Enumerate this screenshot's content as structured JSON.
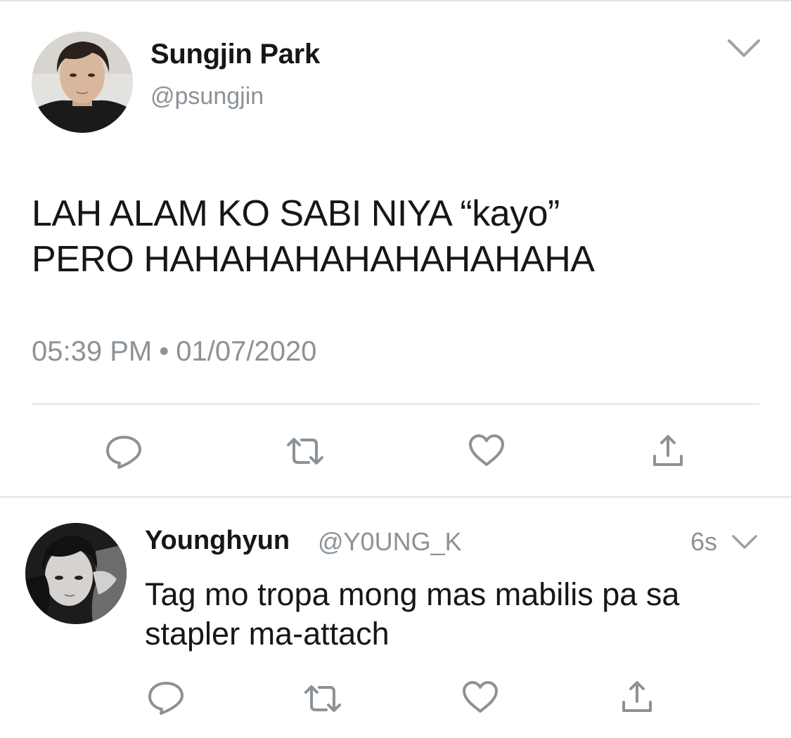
{
  "tweet": {
    "author": {
      "name": "Sungjin Park",
      "handle": "@psungjin"
    },
    "text_lines": [
      "LAH ALAM KO SABI NIYA “kayo”",
      "PERO HAHAHAHAHAHAHAHAHA"
    ],
    "time": "05:39 PM",
    "separator": "•",
    "date": "01/07/2020",
    "actions": [
      "reply-icon",
      "retweet-icon",
      "like-icon",
      "share-icon"
    ]
  },
  "reply": {
    "author": {
      "name": "Younghyun",
      "handle": "@Y0UNG_K"
    },
    "time_ago": "6s",
    "text_lines": [
      "Tag mo tropa mong mas mabilis pa sa",
      "stapler ma-attach"
    ],
    "actions": [
      "reply-icon",
      "retweet-icon",
      "like-icon",
      "share-icon"
    ]
  },
  "colors": {
    "text": "#14171a",
    "secondary": "#8b9298",
    "divider": "#e1e4e6",
    "icon": "#8b9298"
  }
}
